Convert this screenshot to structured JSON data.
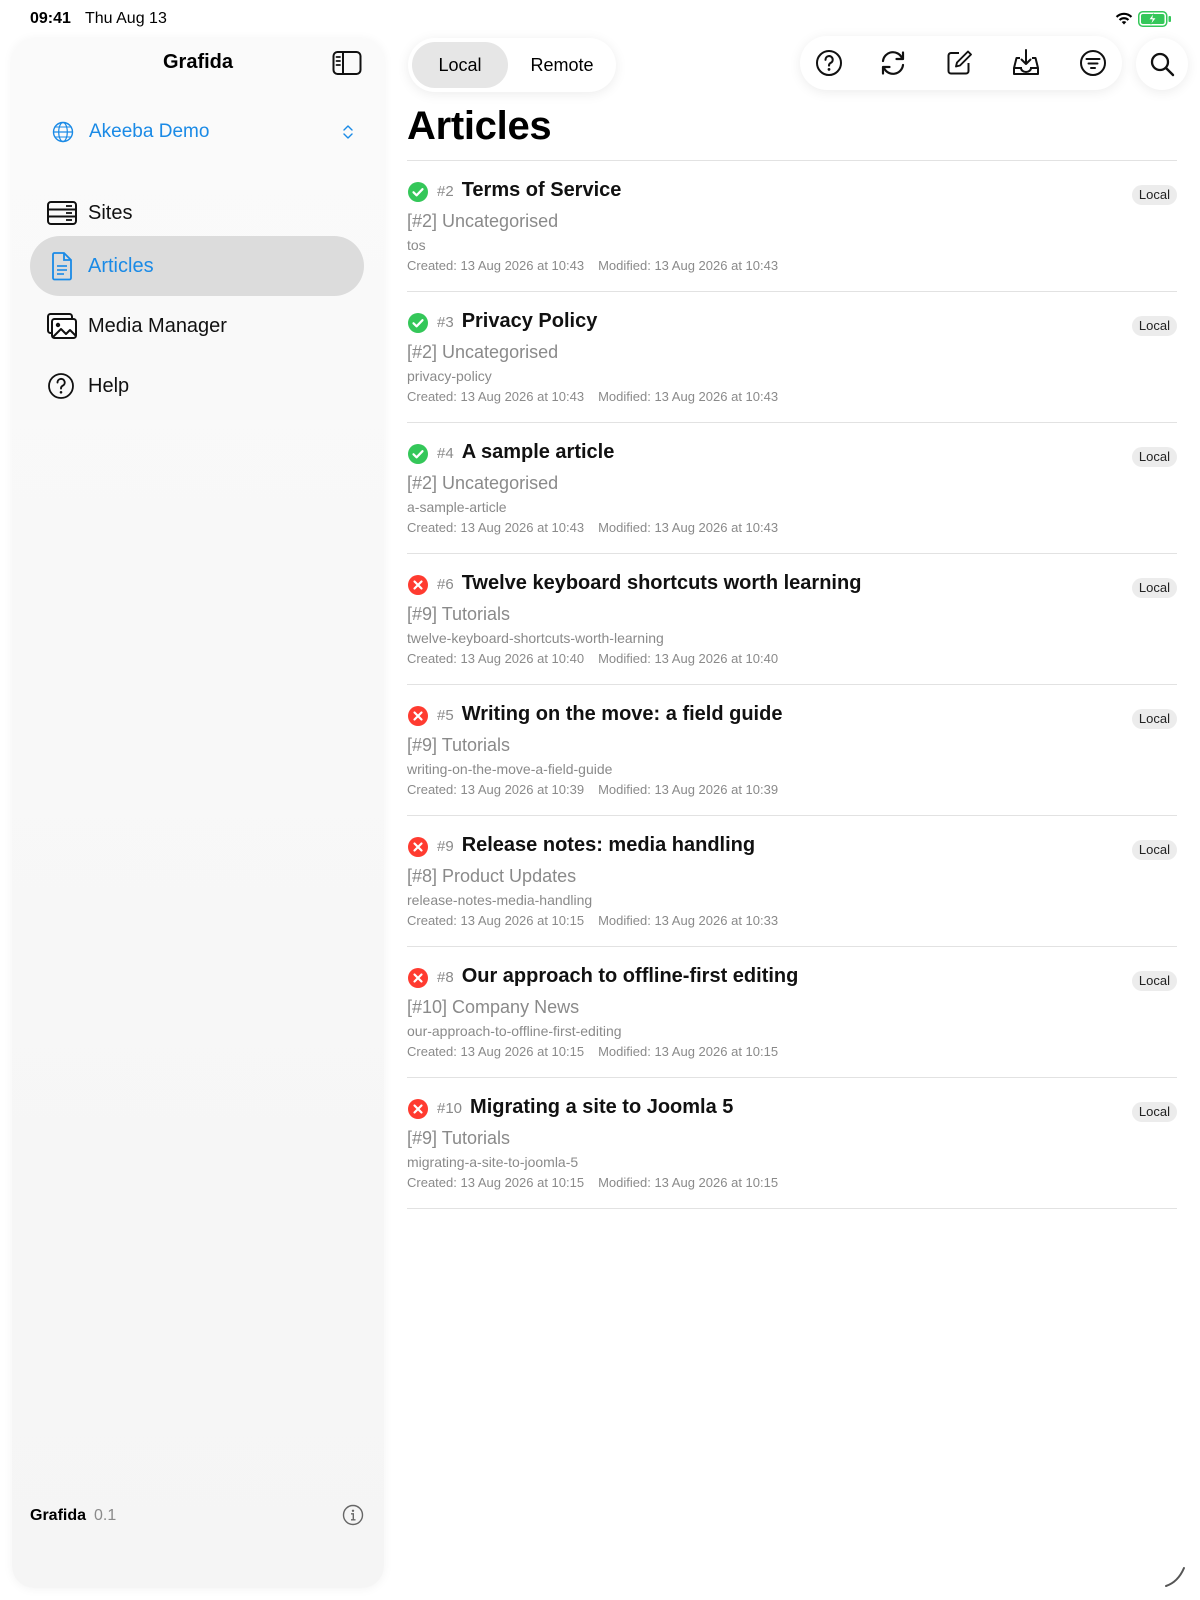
{
  "status_bar": {
    "time": "09:41",
    "date": "Thu Aug 13"
  },
  "sidebar": {
    "title": "Grafida",
    "site_name": "Akeeba Demo",
    "items": [
      {
        "label": "Sites",
        "icon": "server-icon",
        "active": false
      },
      {
        "label": "Articles",
        "icon": "document-icon",
        "active": true
      },
      {
        "label": "Media Manager",
        "icon": "photos-icon",
        "active": false
      },
      {
        "label": "Help",
        "icon": "question-circle-icon",
        "active": false
      }
    ],
    "footer_name": "Grafida",
    "footer_version": "0.1"
  },
  "segmented": {
    "local": "Local",
    "remote": "Remote",
    "selected": "Local"
  },
  "toolbar": {
    "icons": [
      "help-icon",
      "sync-icon",
      "compose-icon",
      "download-tray-icon",
      "filter-icon",
      "search-icon"
    ]
  },
  "page_title": "Articles",
  "articles": [
    {
      "id": "#2",
      "title": "Terms of Service",
      "category": "[#2] Uncategorised",
      "alias": "tos",
      "created": "Created: 13 Aug 2026 at 10:43",
      "modified": "Modified: 13 Aug 2026 at 10:43",
      "badge": "Local",
      "published": true
    },
    {
      "id": "#3",
      "title": "Privacy Policy",
      "category": "[#2] Uncategorised",
      "alias": "privacy-policy",
      "created": "Created: 13 Aug 2026 at 10:43",
      "modified": "Modified: 13 Aug 2026 at 10:43",
      "badge": "Local",
      "published": true
    },
    {
      "id": "#4",
      "title": "A sample article",
      "category": "[#2] Uncategorised",
      "alias": "a-sample-article",
      "created": "Created: 13 Aug 2026 at 10:43",
      "modified": "Modified: 13 Aug 2026 at 10:43",
      "badge": "Local",
      "published": true
    },
    {
      "id": "#6",
      "title": "Twelve keyboard shortcuts worth learning",
      "category": "[#9] Tutorials",
      "alias": "twelve-keyboard-shortcuts-worth-learning",
      "created": "Created: 13 Aug 2026 at 10:40",
      "modified": "Modified: 13 Aug 2026 at 10:40",
      "badge": "Local",
      "published": false
    },
    {
      "id": "#5",
      "title": "Writing on the move: a field guide",
      "category": "[#9] Tutorials",
      "alias": "writing-on-the-move-a-field-guide",
      "created": "Created: 13 Aug 2026 at 10:39",
      "modified": "Modified: 13 Aug 2026 at 10:39",
      "badge": "Local",
      "published": false
    },
    {
      "id": "#9",
      "title": "Release notes: media handling",
      "category": "[#8] Product Updates",
      "alias": "release-notes-media-handling",
      "created": "Created: 13 Aug 2026 at 10:15",
      "modified": "Modified: 13 Aug 2026 at 10:33",
      "badge": "Local",
      "published": false
    },
    {
      "id": "#8",
      "title": "Our approach to offline-first editing",
      "category": "[#10] Company News",
      "alias": "our-approach-to-offline-first-editing",
      "created": "Created: 13 Aug 2026 at 10:15",
      "modified": "Modified: 13 Aug 2026 at 10:15",
      "badge": "Local",
      "published": false
    },
    {
      "id": "#10",
      "title": "Migrating a site to Joomla 5",
      "category": "[#9] Tutorials",
      "alias": "migrating-a-site-to-joomla-5",
      "created": "Created: 13 Aug 2026 at 10:15",
      "modified": "Modified: 13 Aug 2026 at 10:15",
      "badge": "Local",
      "published": false
    }
  ],
  "colors": {
    "accent": "#1a8ae6",
    "published": "#34c759",
    "unpublished": "#ff3b30",
    "selection": "#dcdcdc"
  }
}
